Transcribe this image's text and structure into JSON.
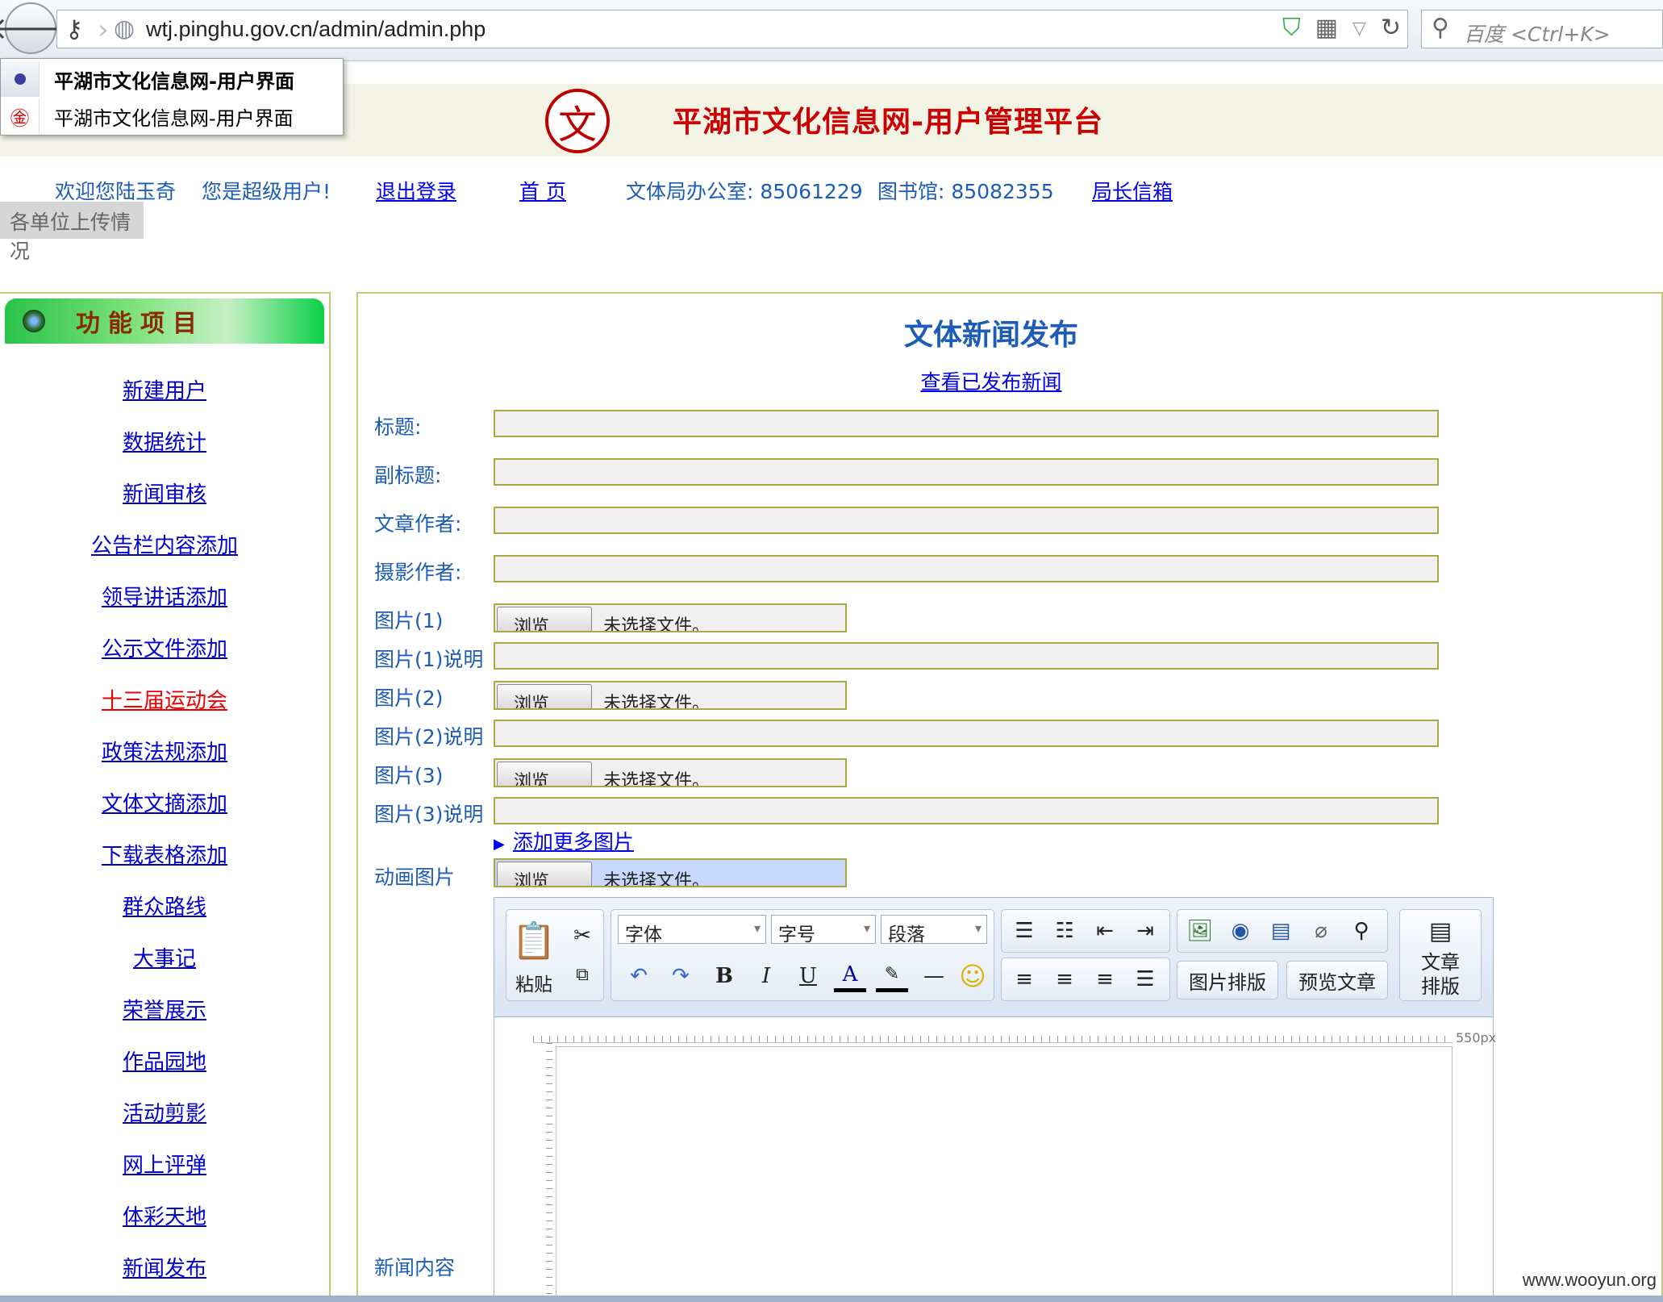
{
  "browser": {
    "url": "wtj.pinghu.gov.cn/admin/admin.php",
    "search_placeholder": "百度 <Ctrl+K>",
    "tabs": [
      {
        "title": "平湖市文化信息网-用户界面"
      },
      {
        "title": "平湖市文化信息网-用户界面"
      }
    ]
  },
  "header": {
    "logo_char": "文",
    "site_title": "平湖市文化信息网-用户管理平台"
  },
  "info_bar": {
    "welcome": "欢迎您陆玉奇",
    "role": "您是超级用户!",
    "logout": "退出登录",
    "home": "首 页",
    "office_phone": "文体局办公室: 85061229",
    "library_phone": "图书馆: 85082355",
    "director_mailbox": "局长信箱",
    "upload_status": "各单位上传情况"
  },
  "sidebar": {
    "title": "功能项目",
    "items": [
      {
        "label": "新建用户"
      },
      {
        "label": "数据统计"
      },
      {
        "label": "新闻审核"
      },
      {
        "label": "公告栏内容添加"
      },
      {
        "label": "领导讲话添加"
      },
      {
        "label": "公示文件添加"
      },
      {
        "label": "十三届运动会"
      },
      {
        "label": "政策法规添加"
      },
      {
        "label": "文体文摘添加"
      },
      {
        "label": "下载表格添加"
      },
      {
        "label": "群众路线"
      },
      {
        "label": "大事记"
      },
      {
        "label": "荣誉展示"
      },
      {
        "label": "作品园地"
      },
      {
        "label": "活动剪影"
      },
      {
        "label": "网上评弹"
      },
      {
        "label": "体彩天地"
      },
      {
        "label": "新闻发布"
      }
    ]
  },
  "form": {
    "title": "文体新闻发布",
    "view_published": "查看已发布新闻",
    "labels": {
      "title": "标题:",
      "subtitle": "副标题:",
      "author": "文章作者:",
      "photographer": "摄影作者:",
      "image1": "图片(1)",
      "image1_desc": "图片(1)说明",
      "image2": "图片(2)",
      "image2_desc": "图片(2)说明",
      "image3": "图片(3)",
      "image3_desc": "图片(3)说明",
      "animation": "动画图片",
      "content": "新闻内容"
    },
    "browse_label": "浏览",
    "no_file": "未选择文件。",
    "add_more_images": "添加更多图片"
  },
  "editor": {
    "paste": "粘贴",
    "font": "字体",
    "size": "字号",
    "paragraph": "段落",
    "image_layout": "图片排版",
    "preview": "预览文章",
    "article_layout_1": "文章",
    "article_layout_2": "排版",
    "ruler_label": "550px",
    "bold": "B",
    "italic": "I",
    "underline": "U",
    "font_color": "A"
  },
  "watermark": "www.wooyun.org"
}
